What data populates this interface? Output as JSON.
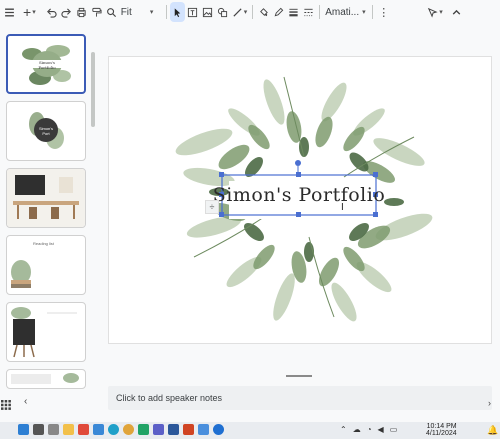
{
  "toolbar": {
    "zoom_value": "Fit",
    "font_value": "Amati..."
  },
  "slide": {
    "title": "Simon's Portfolio"
  },
  "thumbnails": [
    {
      "title": "Simon's Portfolio"
    },
    {
      "title": "Simon's Port"
    },
    {
      "title": ""
    },
    {
      "title": "Reading list"
    },
    {
      "title": ""
    },
    {
      "title": ""
    }
  ],
  "notes": {
    "placeholder": "Click to add speaker notes"
  },
  "taskbar": {
    "time": "10:14 PM",
    "date": "4/11/2024"
  },
  "colors": {
    "accent": "#3b5bb6",
    "leaf_dark": "#4d6b45",
    "leaf_light": "#9fb893",
    "selection": "#4a6fd1"
  },
  "icons": [
    "add-icon",
    "undo-icon",
    "redo-icon",
    "print-icon",
    "paint-format-icon",
    "zoom-icon",
    "select-icon",
    "textbox-icon",
    "image-icon",
    "shape-icon",
    "line-icon",
    "fill-color-icon",
    "border-color-icon",
    "border-weight-icon",
    "border-dash-icon",
    "more-icon",
    "pointer-icon",
    "grid-view-icon",
    "collapse-icon"
  ]
}
